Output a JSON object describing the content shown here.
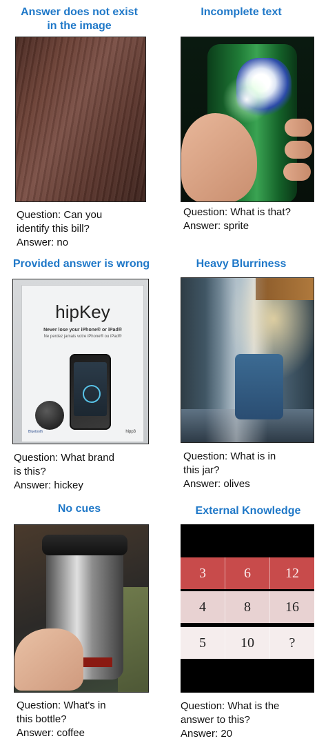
{
  "panels": [
    {
      "title_lines": [
        "Answer does not exist",
        "in the image"
      ],
      "caption_lines": [
        "Question: Can you",
        "identify this bill?",
        "Answer: no"
      ]
    },
    {
      "title_lines": [
        "Incomplete text"
      ],
      "caption_lines": [
        "Question: What is that?",
        "Answer: sprite"
      ]
    },
    {
      "title_lines": [
        "Provided answer is wrong"
      ],
      "caption_lines": [
        "Question: What brand",
        "is this?",
        "Answer: hickey"
      ],
      "photo_text": {
        "brand": "hipKey",
        "tagline": "Never lose your iPhone® or iPad®",
        "tagline_fr": "Ne perdez jamais votre iPhone® ou iPad®",
        "foot_left": "Bluetooth",
        "foot_right": "hipp3"
      }
    },
    {
      "title_lines": [
        "Heavy Blurriness"
      ],
      "caption_lines": [
        "Question: What is in",
        "this jar?",
        "Answer: olives"
      ]
    },
    {
      "title_lines": [
        "No cues"
      ],
      "caption_lines": [
        "Question: What's in",
        "this bottle?",
        "Answer: coffee"
      ]
    },
    {
      "title_lines": [
        "External Knowledge"
      ],
      "caption_lines": [
        "Question: What is the",
        "answer to this?",
        "Answer: 20"
      ],
      "grid": [
        [
          "3",
          "6",
          "12"
        ],
        [
          "4",
          "8",
          "16"
        ],
        [
          "5",
          "10",
          "?"
        ]
      ]
    }
  ],
  "colors": {
    "title": "#1f78c8",
    "text": "#111111"
  }
}
